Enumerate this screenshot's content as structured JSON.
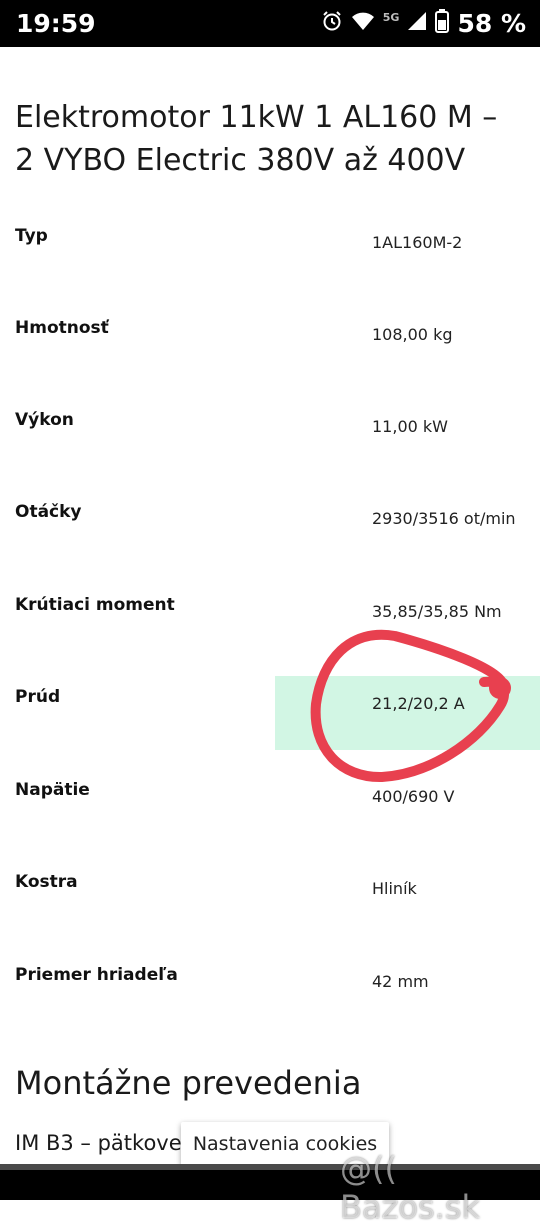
{
  "status_bar": {
    "time": "19:59",
    "network": "5G",
    "battery_percent": "58 %"
  },
  "product": {
    "title": "Elektromotor 11kW 1 AL160 M – 2 VYBO Electric 380V až 400V"
  },
  "specs": [
    {
      "label": "Typ",
      "value": "1AL160M-2"
    },
    {
      "label": "Hmotnosť",
      "value": "108,00 kg"
    },
    {
      "label": "Výkon",
      "value": "11,00 kW"
    },
    {
      "label": "Otáčky",
      "value": "2930/3516 ot/min"
    },
    {
      "label": "Krútiaci moment",
      "value": "35,85/35,85 Nm"
    },
    {
      "label": "Prúd",
      "value": "21,2/20,2 A"
    },
    {
      "label": "Napätie",
      "value": "400/690 V"
    },
    {
      "label": "Kostra",
      "value": "Hliník"
    },
    {
      "label": "Priemer hriadeľa",
      "value": "42 mm"
    }
  ],
  "mounting": {
    "title": "Montážne prevedenia",
    "first_item": "IM B3 – pätkove"
  },
  "cookie_button": {
    "label": "Nastavenia cookies"
  },
  "watermark": "@(( Bazos.sk",
  "colors": {
    "highlight": "#d2f6e4",
    "annotation_circle": "#e8404f"
  }
}
